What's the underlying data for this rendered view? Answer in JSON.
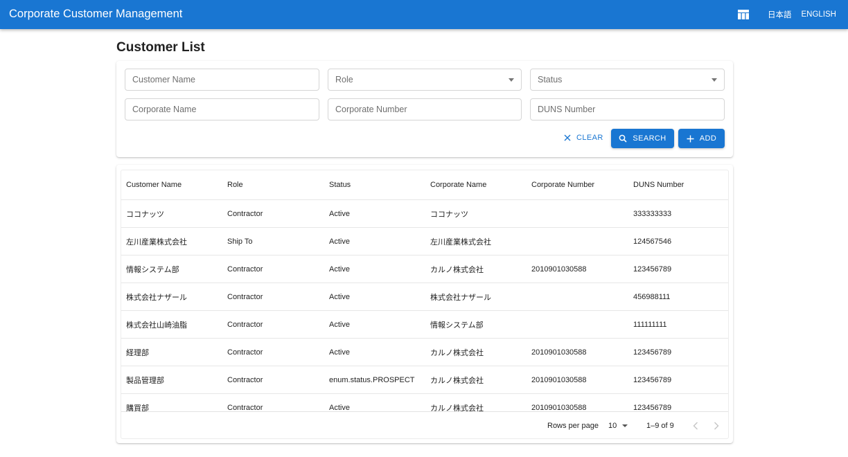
{
  "appbar": {
    "title": "Corporate Customer Management",
    "lang_ja": "日本語",
    "lang_en": "ENGLISH"
  },
  "page": {
    "title": "Customer List"
  },
  "filters": {
    "customer_name": "Customer Name",
    "role": "Role",
    "status": "Status",
    "corporate_name": "Corporate Name",
    "corporate_number": "Corporate Number",
    "duns_number": "DUNS Number",
    "clear_label": "CLEAR",
    "search_label": "SEARCH",
    "add_label": "ADD"
  },
  "table": {
    "columns": [
      "Customer Name",
      "Role",
      "Status",
      "Corporate Name",
      "Corporate Number",
      "DUNS Number"
    ],
    "rows": [
      [
        "ココナッツ",
        "Contractor",
        "Active",
        "ココナッツ",
        "",
        "333333333"
      ],
      [
        "左川産業株式会社",
        "Ship To",
        "Active",
        "左川産業株式会社",
        "",
        "124567546"
      ],
      [
        "情報システム部",
        "Contractor",
        "Active",
        "カルノ株式会社",
        "2010901030588",
        "123456789"
      ],
      [
        "株式会社ナザール",
        "Contractor",
        "Active",
        "株式会社ナザール",
        "",
        "456988111"
      ],
      [
        "株式会社山崎油脂",
        "Contractor",
        "Active",
        "情報システム部",
        "",
        "111111111"
      ],
      [
        "経理部",
        "Contractor",
        "Active",
        "カルノ株式会社",
        "2010901030588",
        "123456789"
      ],
      [
        "製品管理部",
        "Contractor",
        "enum.status.PROSPECT",
        "カルノ株式会社",
        "2010901030588",
        "123456789"
      ],
      [
        "購買部",
        "Contractor",
        "Active",
        "カルノ株式会社",
        "2010901030588",
        "123456789"
      ]
    ],
    "pagination": {
      "rows_per_page_label": "Rows per page",
      "rows_per_page": "10",
      "range": "1–9 of 9"
    }
  }
}
